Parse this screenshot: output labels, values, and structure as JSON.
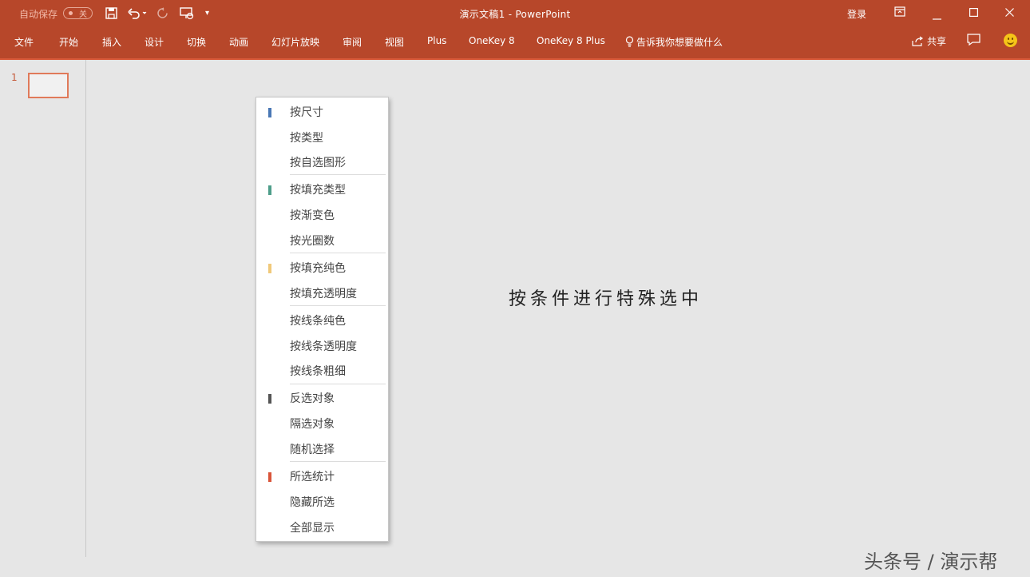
{
  "titlebar": {
    "autosave_label": "自动保存",
    "autosave_state": "关",
    "title": "演示文稿1  -  PowerPoint",
    "login": "登录"
  },
  "ribbon": {
    "tabs": [
      "文件",
      "开始",
      "插入",
      "设计",
      "切换",
      "动画",
      "幻灯片放映",
      "审阅",
      "视图",
      "Plus",
      "OneKey 8",
      "OneKey 8 Plus"
    ],
    "tell_me": "告诉我你想要做什么",
    "share": "共享"
  },
  "slides": {
    "number": "1"
  },
  "canvas": {
    "text": "按条件进行特殊选中"
  },
  "menu": {
    "groups": [
      {
        "color": "#4a78b5",
        "items": [
          "按尺寸",
          "按类型",
          "按自选图形"
        ]
      },
      {
        "color": "#4e9e8a",
        "items": [
          "按填充类型",
          "按渐变色",
          "按光圈数"
        ]
      },
      {
        "color": "#f0c97a",
        "items": [
          "按填充纯色",
          "按填充透明度"
        ]
      },
      {
        "color": "",
        "items": [
          "按线条纯色",
          "按线条透明度",
          "按线条粗细"
        ]
      },
      {
        "color": "#555555",
        "items": [
          "反选对象",
          "隔选对象",
          "随机选择"
        ]
      },
      {
        "color": "#d9553a",
        "items": [
          "所选统计",
          "隐藏所选",
          "全部显示"
        ]
      }
    ]
  },
  "watermark": "头条号 / 演示帮",
  "colors": {
    "accent": "#b7472a"
  }
}
